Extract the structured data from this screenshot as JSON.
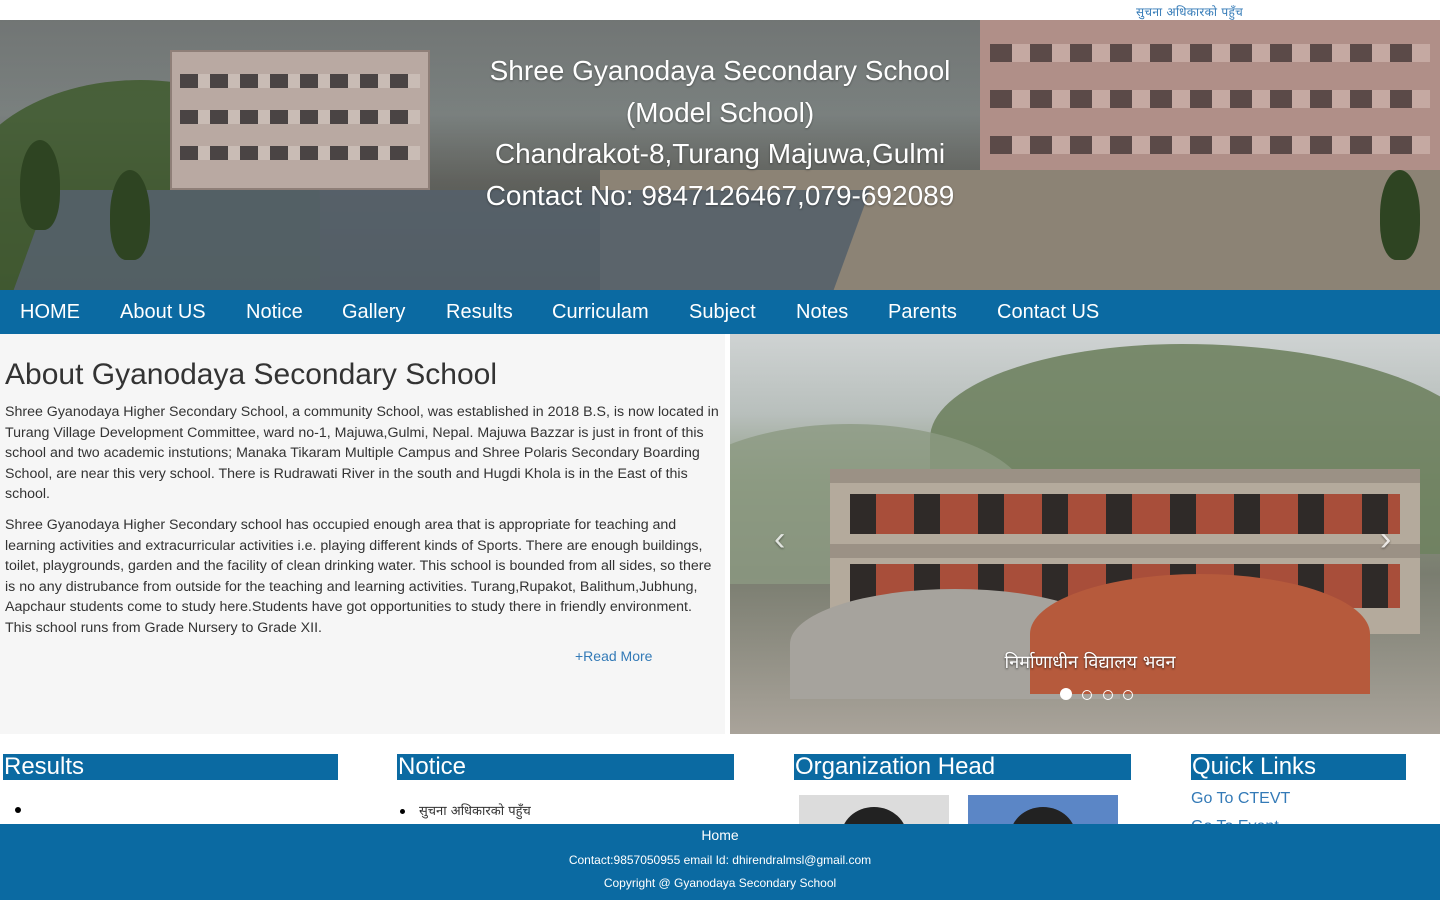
{
  "topbar": {
    "link": "सुचना अधिकारको पहुँच"
  },
  "banner": {
    "line1": "Shree Gyanodaya Secondary School",
    "line2": "(Model School)",
    "line3": "Chandrakot-8,Turang Majuwa,Gulmi",
    "line4": "Contact No: 9847126467,079-692089"
  },
  "nav": {
    "items": [
      "HOME",
      "About US",
      "Notice",
      "Gallery",
      "Results",
      "Curriculam",
      "Subject",
      "Notes",
      "Parents",
      "Contact US"
    ]
  },
  "about": {
    "title": "About Gyanodaya Secondary School",
    "para1": "Shree Gyanodaya Higher Secondary School, a community School, was established in 2018 B.S, is now located in Turang Village Development Committee, ward no-1, Majuwa,Gulmi, Nepal. Majuwa Bazzar is just in front of this school and two academic instutions; Manaka Tikaram Multiple Campus and Shree Polaris Secondary Boarding School, are near this very school. There is Rudrawati River in the south and Hugdi Khola is in the East of this school.",
    "para2": "Shree Gyanodaya Higher Secondary school has occupied enough area that is appropriate for teaching and learning activities and extracurricular activities i.e. playing different kinds of Sports. There are enough buildings, toilet, playgrounds, garden and the facility of clean drinking water. This school is bounded from all sides, so there is no any distrubance from outside for the teaching and learning activities. Turang,Rupakot, Balithum,Jubhung, Aapchaur students come to study here.Students have got opportunities to study there in friendly environment. This school runs from Grade Nursery to Grade XII.",
    "read_more": "+Read More"
  },
  "carousel": {
    "prev_icon": "chevron-left-icon",
    "next_icon": "chevron-right-icon",
    "prev_glyph": "‹",
    "next_glyph": "›",
    "caption": "निर्माणाधीन विद्यालय भवन",
    "slide_count": 4,
    "active_index": 0
  },
  "sections": {
    "results": {
      "title": "Results"
    },
    "notice": {
      "title": "Notice",
      "items": [
        "सुचना अधिकारको पहुँच"
      ]
    },
    "org_head": {
      "title": "Organization Head"
    },
    "quick_links": {
      "title": "Quick Links",
      "items": [
        "Go To CTEVT",
        "Go To Event"
      ]
    }
  },
  "footer": {
    "home": "Home",
    "contact": "Contact:9857050955 email Id: dhirendralmsl@gmail.com",
    "copyright": "Copyright @ Gyanodaya Secondary School"
  },
  "colors": {
    "primary": "#0b6aa2",
    "link": "#337ab7",
    "about_bg": "#f6f6f6"
  }
}
